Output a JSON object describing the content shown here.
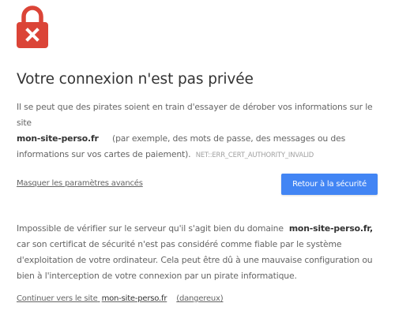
{
  "icon": {
    "name": "lock-error-icon",
    "color": "#db4437",
    "mark_color": "#ffffff"
  },
  "title": "Votre connexion n'est pas privée",
  "intro": {
    "text_before": "Il se peut que des pirates soient en train d'essayer de dérober vos informations sur le site",
    "domain": "mon-site-perso.fr",
    "text_after": "(par exemple, des mots de passe, des messages ou des informations sur vos cartes de paiement).",
    "error_code": "NET::ERR_CERT_AUTHORITY_INVALID"
  },
  "actions": {
    "advanced_link": "Masquer les paramètres avancés",
    "back_button": "Retour à la sécurité",
    "button_color": "#4285f4"
  },
  "details": {
    "text_before": "Impossible de vérifier sur le serveur qu'il s'agit bien du domaine",
    "domain": "mon-site-perso.fr,",
    "text_after": "car son certificat de sécurité n'est pas considéré comme fiable par le système d'exploitation de votre ordinateur. Cela peut être dû à une mauvaise configuration ou bien à l'interception de votre connexion par un pirate informatique."
  },
  "proceed": {
    "prefix": "Continuer vers le site",
    "domain": "mon-site-perso.fr",
    "suffix": "(dangereux)"
  }
}
